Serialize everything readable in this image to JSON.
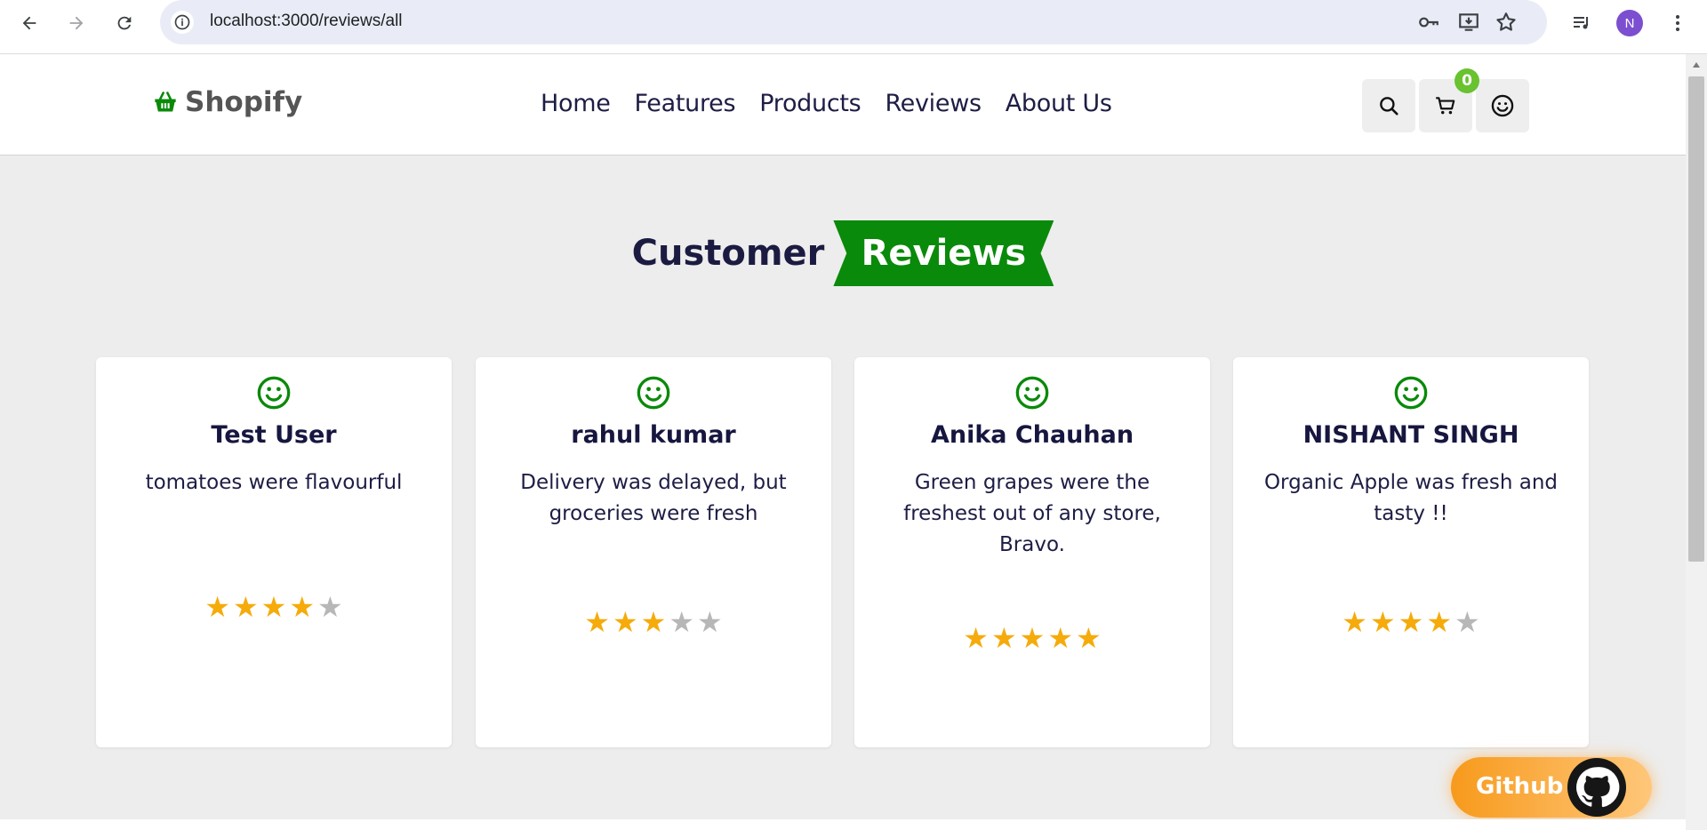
{
  "browser": {
    "url": "localhost:3000/reviews/all",
    "profile_initial": "N"
  },
  "site": {
    "brand": "Shopify",
    "brand_color": "#0a8a0a",
    "nav": [
      "Home",
      "Features",
      "Products",
      "Reviews",
      "About Us"
    ],
    "cart_count": "0",
    "actions": [
      "search-icon",
      "cart-icon",
      "smiley-icon"
    ]
  },
  "heading": {
    "plain": "Customer",
    "highlight": "Reviews",
    "highlight_color": "#0a8a0a"
  },
  "reviews": [
    {
      "name": "Test User",
      "text": "tomatoes were flavourful",
      "rating": 4
    },
    {
      "name": "rahul kumar",
      "text": "Delivery was delayed, but groceries were fresh",
      "rating": 3
    },
    {
      "name": "Anika Chauhan",
      "text": "Green grapes were the freshest out of any store, Bravo.",
      "rating": 5
    },
    {
      "name": "NISHANT SINGH",
      "text": "Organic Apple was fresh and tasty !!",
      "rating": 4
    }
  ],
  "rating_max": 5,
  "star_color": "#f5ab0b",
  "github": {
    "label": "Github"
  }
}
